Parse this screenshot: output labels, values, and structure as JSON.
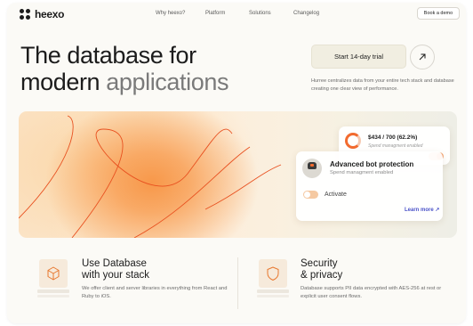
{
  "brand": {
    "name": "heexo"
  },
  "nav": {
    "links": [
      "Why heexo?",
      "Platform",
      "Solutions",
      "Changelog"
    ],
    "cta": "Book a demo"
  },
  "hero": {
    "title_line1": "The database for",
    "title_line2_a": "modern",
    "title_line2_b": "applications",
    "trial_button": "Start 14-day trial",
    "description": "Hurree centralizes data from your entire tech stack and database creating one clear view of performance."
  },
  "cards": {
    "spend": {
      "value": "$434 / 700 (62.2%)",
      "subtitle": "Spend managment enabled",
      "progress": 0.622
    },
    "bot": {
      "title": "Advanced bot protection",
      "subtitle": "Spend managment enabled",
      "activate": "Activate",
      "learn_more": "Learn more ↗"
    }
  },
  "features": [
    {
      "title_line1": "Use Database",
      "title_line2": "with your stack",
      "description": "We offer client and server libraries in everything from React and Ruby to iOS.",
      "icon": "cube-icon"
    },
    {
      "title_line1": "Security",
      "title_line2": "& privacy",
      "description": "Database supports PII data encrypted with AES-256 at rest or explicit user consent flows.",
      "icon": "shield-icon"
    }
  ],
  "colors": {
    "accent": "#f26b2f",
    "link": "#4a52c9",
    "text": "#1c1c1c"
  }
}
